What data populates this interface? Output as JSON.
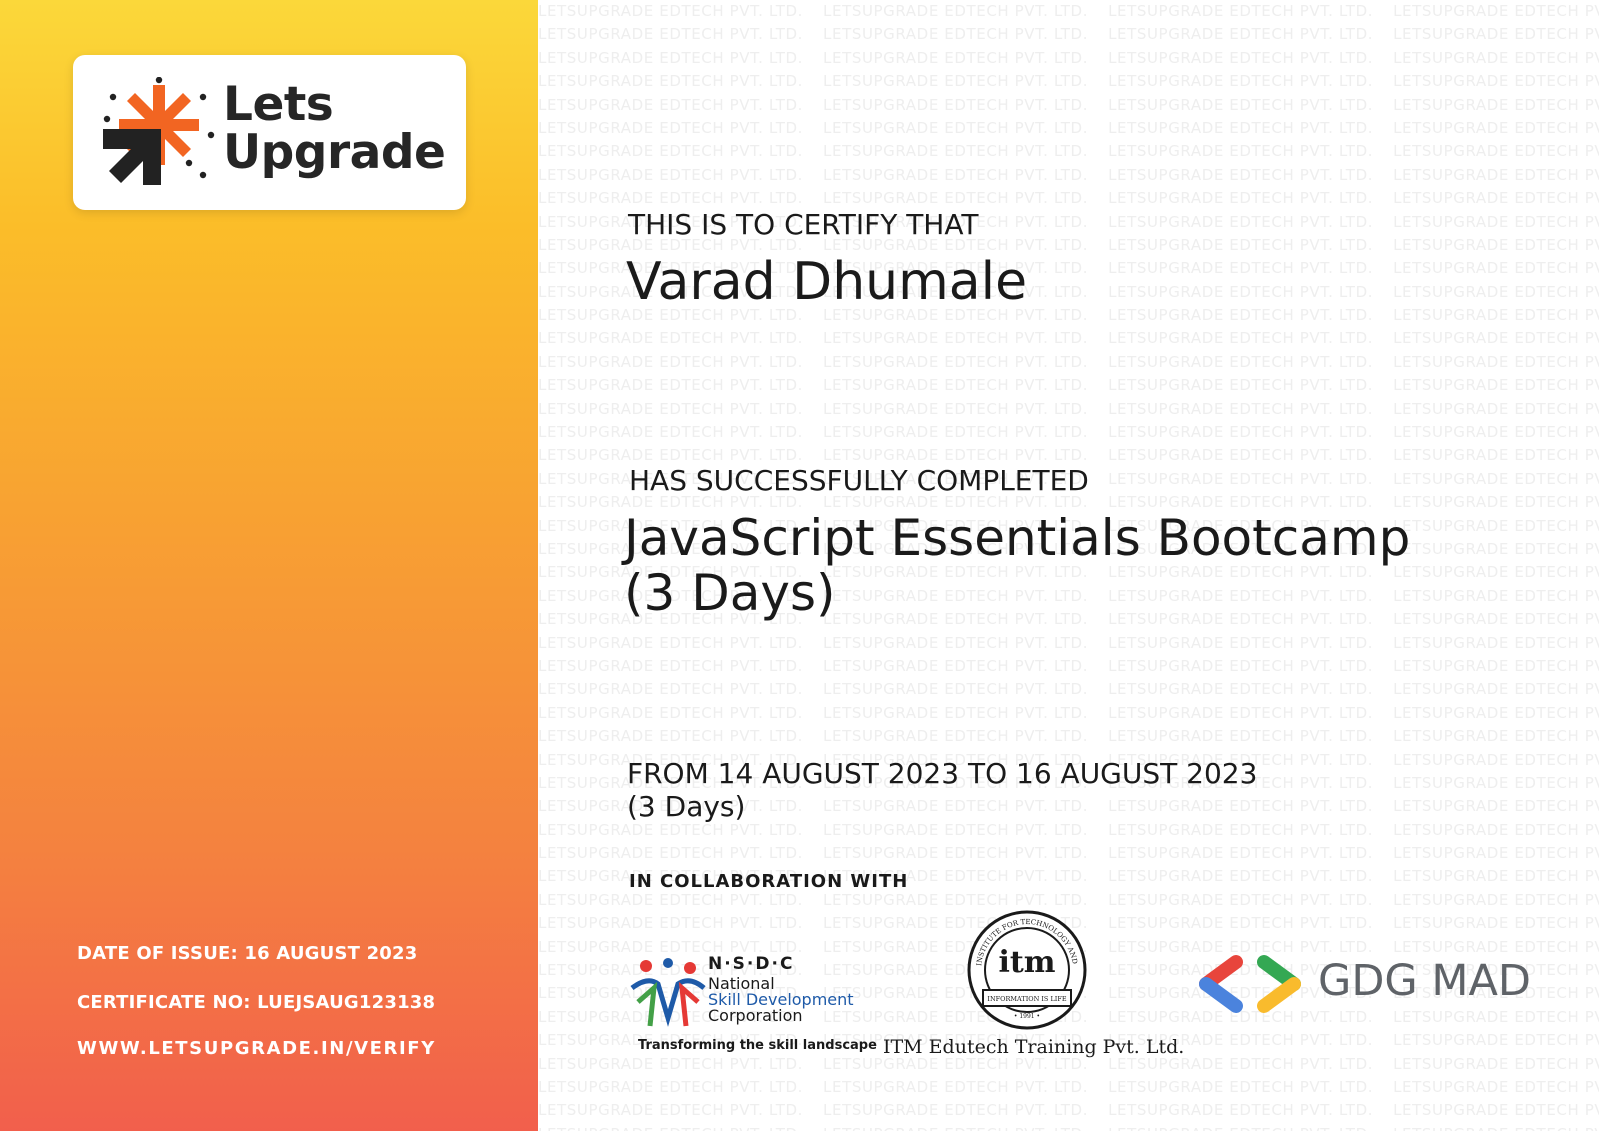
{
  "logo": {
    "line1": "Lets",
    "line2": "Upgrade",
    "colors": {
      "orange": "#f26522",
      "dark": "#222222"
    }
  },
  "issue": {
    "date": "DATE OF ISSUE: 16 AUGUST 2023",
    "certificate_no": "CERTIFICATE NO: LUEJSAUG123138",
    "verify_url": "WWW.LETSUPGRADE.IN/VERIFY"
  },
  "watermark": "LETSUPGRADE EDTECH PVT. LTD.",
  "certificate": {
    "certify_line": "THIS IS TO CERTIFY THAT",
    "recipient": "Varad Dhumale",
    "completed_line": "HAS SUCCESSFULLY COMPLETED",
    "course_line1": "JavaScript Essentials Bootcamp",
    "course_line2": "(3 Days)",
    "period": "FROM 14 AUGUST 2023 TO 16 AUGUST 2023",
    "duration": "(3 Days)",
    "collab_heading": "IN COLLABORATION WITH"
  },
  "partners": {
    "nsdc": {
      "acronym": "N·S·D·C",
      "name_line1": "National",
      "name_line2": "Skill Development",
      "name_line3": "Corporation",
      "tagline": "Transforming the skill landscape"
    },
    "itm": {
      "seal_text": "itm",
      "ring_text_top": "INSTITUTE FOR TECHNOLOGY AND MANAGEMENT",
      "ribbon_text": "INFORMATION IS LIFE",
      "year": "• 1991 •",
      "caption": "ITM Edutech Training Pvt. Ltd."
    },
    "gdg": {
      "label": "GDG MAD",
      "colors": {
        "blue": "#4b83dd",
        "red": "#e8453c",
        "green": "#34a853",
        "yellow": "#f9bb2d"
      }
    }
  }
}
